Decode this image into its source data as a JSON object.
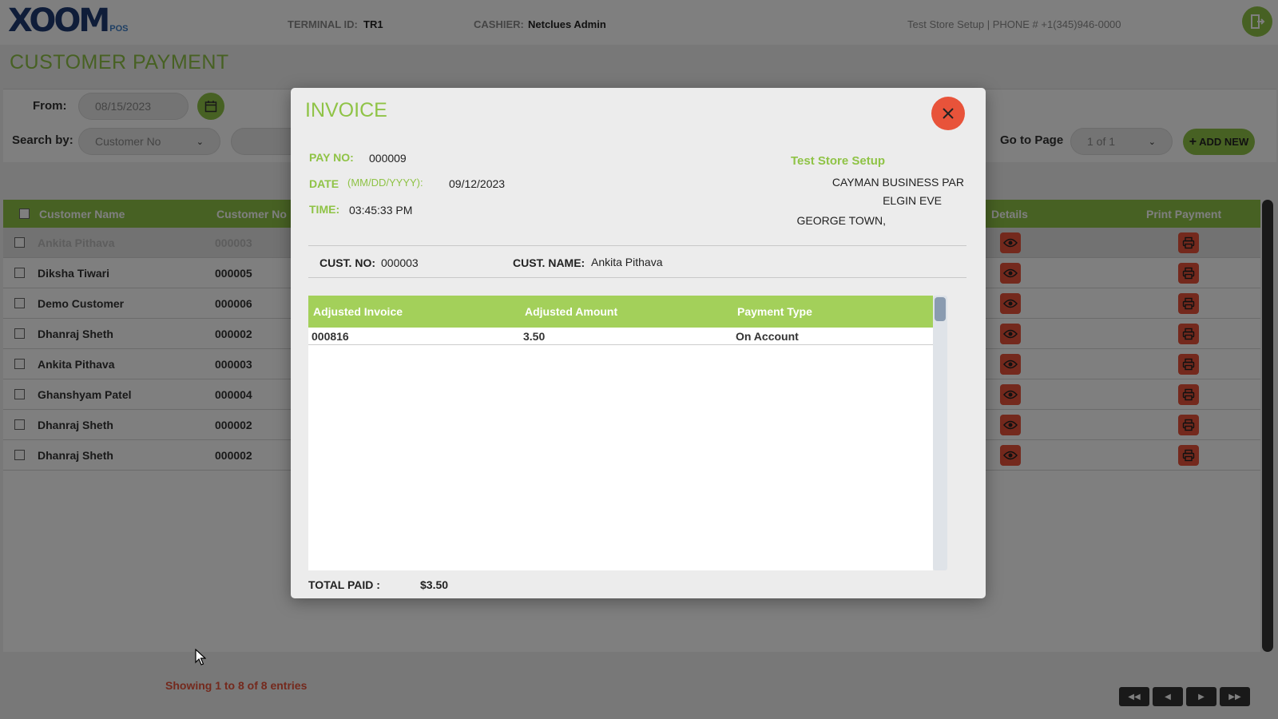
{
  "header": {
    "logo_text": "XOOM",
    "logo_suffix": "POS",
    "terminal_label": "TERMINAL ID:",
    "terminal_value": "TR1",
    "cashier_label": "CASHIER:",
    "cashier_value": "Netclues Admin",
    "store_info": "Test Store Setup | PHONE # +1(345)946-0000"
  },
  "page_title": "CUSTOMER PAYMENT",
  "filters": {
    "from_label": "From:",
    "from_value": "08/15/2023",
    "search_label": "Search by:",
    "search_select": "Customer No",
    "go_to_page_label": "Go to Page",
    "page_select": "1 of 1",
    "add_new_label": "ADD NEW"
  },
  "table": {
    "columns": [
      "Customer Name",
      "Customer No",
      "Details",
      "Print Payment"
    ],
    "rows": [
      {
        "name": "Ankita Pithava",
        "no": "000003",
        "selected": true
      },
      {
        "name": "Diksha Tiwari",
        "no": "000005"
      },
      {
        "name": "Demo Customer",
        "no": "000006"
      },
      {
        "name": "Dhanraj Sheth",
        "no": "000002"
      },
      {
        "name": "Ankita Pithava",
        "no": "000003"
      },
      {
        "name": "Ghanshyam Patel",
        "no": "000004"
      },
      {
        "name": "Dhanraj Sheth",
        "no": "000002"
      },
      {
        "name": "Dhanraj Sheth",
        "no": "000002"
      }
    ]
  },
  "footer": {
    "entries_text": "Showing 1 to 8 of 8 entries"
  },
  "modal": {
    "title": "INVOICE",
    "pay_no_label": "PAY NO:",
    "pay_no_value": "000009",
    "date_label": "DATE",
    "date_format": "(MM/DD/YYYY):",
    "date_value": "09/12/2023",
    "time_label": "TIME:",
    "time_value": "03:45:33 PM",
    "store_name": "Test Store Setup",
    "address_line1": "CAYMAN BUSINESS PAR",
    "address_line2": "ELGIN EVE",
    "address_line3": "GEORGE TOWN,",
    "cust_no_label": "CUST. NO:",
    "cust_no_value": "000003",
    "cust_name_label": "CUST. NAME:",
    "cust_name_value": "Ankita Pithava",
    "invoice_columns": [
      "Adjusted Invoice",
      "Adjusted Amount",
      "Payment Type"
    ],
    "invoice_rows": [
      {
        "invoice": "000816",
        "amount": "3.50",
        "type": "On Account"
      }
    ],
    "total_label": "TOTAL PAID :",
    "total_value": "$3.50"
  },
  "colors": {
    "accent_green": "#8fc346",
    "accent_red": "#e8533a",
    "brand_blue": "#1e3a73"
  }
}
